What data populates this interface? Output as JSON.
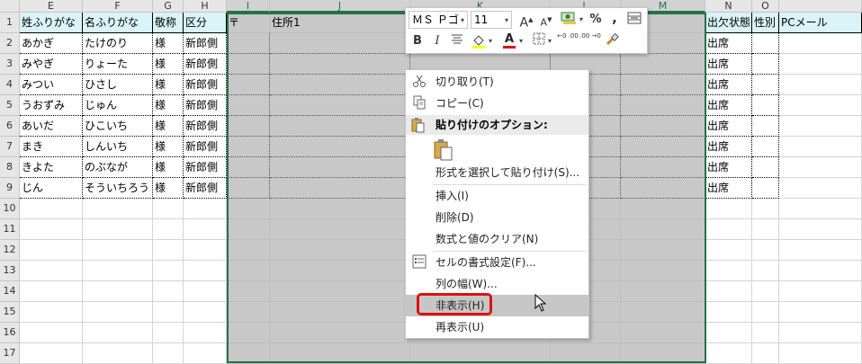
{
  "columns": [
    "E",
    "F",
    "G",
    "H",
    "I",
    "J",
    "K",
    "L",
    "M",
    "N",
    "O",
    ""
  ],
  "row_numbers": [
    "1",
    "2",
    "3",
    "4",
    "5",
    "6",
    "7",
    "8",
    "9",
    "10",
    "11",
    "12",
    "13",
    "14",
    "15",
    "16",
    "17"
  ],
  "header_row": [
    "姓ふりがな",
    "名ふりがな",
    "敬称",
    "区分",
    "〒",
    "住所1",
    "",
    "",
    "",
    "出欠状態",
    "性別",
    "PCメール"
  ],
  "data_rows": [
    [
      "あかぎ",
      "たけのり",
      "様",
      "新郎側",
      "出席"
    ],
    [
      "みやぎ",
      "りょーた",
      "様",
      "新郎側",
      "出席"
    ],
    [
      "みつい",
      "ひさし",
      "様",
      "新郎側",
      "出席"
    ],
    [
      "うおずみ",
      "じゅん",
      "様",
      "新郎側",
      "出席"
    ],
    [
      "あいだ",
      "ひこいち",
      "様",
      "新郎側",
      "出席"
    ],
    [
      "まき",
      "しんいち",
      "様",
      "新郎側",
      "出席"
    ],
    [
      "きよた",
      "のぶなが",
      "様",
      "新郎側",
      "出席"
    ],
    [
      "じん",
      "そういちろう",
      "様",
      "新郎側",
      "出席"
    ]
  ],
  "mini_toolbar": {
    "font_name": "ＭＳ Ｐゴ",
    "font_size": "11",
    "grow_font": "A",
    "shrink_font": "A",
    "percent": "%",
    "comma": ",",
    "bold": "B",
    "italic": "I",
    "font_color_glyph": "A",
    "inc_decimal": "←0 .00",
    "dec_decimal": ".00 →0"
  },
  "context_menu": {
    "cut": "切り取り(T)",
    "copy": "コピー(C)",
    "paste_options": "貼り付けのオプション:",
    "paste_special": "形式を選択して貼り付け(S)...",
    "insert": "挿入(I)",
    "delete": "削除(D)",
    "clear": "数式と値のクリア(N)",
    "format_cells": "セルの書式設定(F)...",
    "column_width": "列の幅(W)...",
    "hide": "非表示(H)",
    "unhide": "再表示(U)"
  },
  "colors": {
    "header_fill": "#d9f3f7",
    "selection_gray": "#c8c8c8",
    "excel_green": "#217346",
    "highlight_red": "#e01010"
  },
  "icons": {
    "cut": "scissors-icon",
    "copy": "copy-icon",
    "paste": "paste-icon",
    "format": "format-cells-icon"
  }
}
